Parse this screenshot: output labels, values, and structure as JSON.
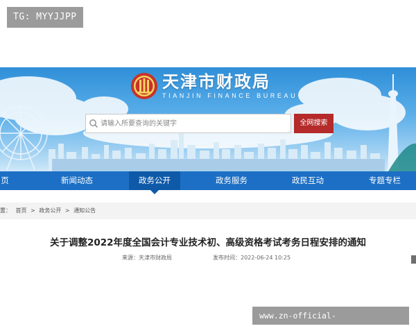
{
  "overlay": {
    "top_tag": "TG: MYYJJPP",
    "bottom_tag": "www.zn-official-kaiyunsports.com"
  },
  "header": {
    "site_name_cn": "天津市财政局",
    "site_name_en": "TIANJIN FINANCE BUREAU",
    "emblem_icon": "emblem-icon"
  },
  "search": {
    "placeholder": "请输入所要查询的关键字",
    "button_label": "全网搜索",
    "button_color": "#b52a2a"
  },
  "nav": {
    "items": [
      {
        "label": "页"
      },
      {
        "label": "新闻动态"
      },
      {
        "label": "政务公开"
      },
      {
        "label": "政务服务"
      },
      {
        "label": "政民互动"
      },
      {
        "label": "专题专栏"
      }
    ],
    "active_index": 2,
    "bar_color": "#1c6fc4"
  },
  "breadcrumb": {
    "prefix": "置：",
    "items": [
      "首页",
      "政务公开",
      "通知公告"
    ],
    "separator": ">"
  },
  "article": {
    "title": "关于调整2022年度全国会计专业技术初、高级资格考试考务日程安排的通知",
    "source": "来源：天津市财政局",
    "date": "发布时间：2022-06-24 10:25"
  }
}
